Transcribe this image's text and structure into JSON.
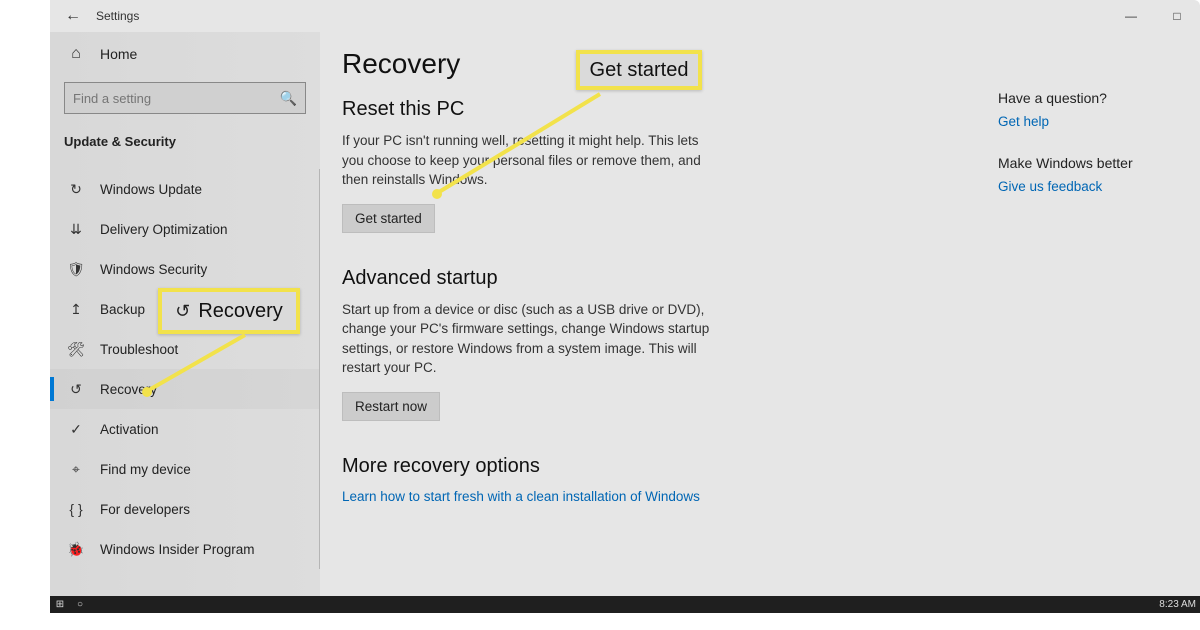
{
  "window": {
    "title": "Settings",
    "controls": {
      "minimize": "—",
      "maximize": "□"
    }
  },
  "sidebar": {
    "home": "Home",
    "search_placeholder": "Find a setting",
    "section": "Update & Security",
    "items": [
      {
        "icon": "↻",
        "label": "Windows Update"
      },
      {
        "icon": "⇊",
        "label": "Delivery Optimization"
      },
      {
        "icon": "🛡",
        "label": "Windows Security"
      },
      {
        "icon": "↥",
        "label": "Backup"
      },
      {
        "icon": "🛠",
        "label": "Troubleshoot"
      },
      {
        "icon": "↺",
        "label": "Recovery"
      },
      {
        "icon": "✓",
        "label": "Activation"
      },
      {
        "icon": "⌖",
        "label": "Find my device"
      },
      {
        "icon": "{ }",
        "label": "For developers"
      },
      {
        "icon": "🐞",
        "label": "Windows Insider Program"
      }
    ],
    "active_index": 5
  },
  "main": {
    "title": "Recovery",
    "reset": {
      "heading": "Reset this PC",
      "body": "If your PC isn't running well, resetting it might help. This lets you choose to keep your personal files or remove them, and then reinstalls Windows.",
      "button": "Get started"
    },
    "advanced": {
      "heading": "Advanced startup",
      "body": "Start up from a device or disc (such as a USB drive or DVD), change your PC's firmware settings, change Windows startup settings, or restore Windows from a system image. This will restart your PC.",
      "button": "Restart now"
    },
    "more": {
      "heading": "More recovery options",
      "link": "Learn how to start fresh with a clean installation of Windows"
    }
  },
  "right": {
    "q_heading": "Have a question?",
    "q_link": "Get help",
    "f_heading": "Make Windows better",
    "f_link": "Give us feedback"
  },
  "callouts": {
    "recovery_label": "Recovery",
    "getstarted_label": "Get started"
  },
  "taskbar": {
    "time": "8:23 AM"
  }
}
